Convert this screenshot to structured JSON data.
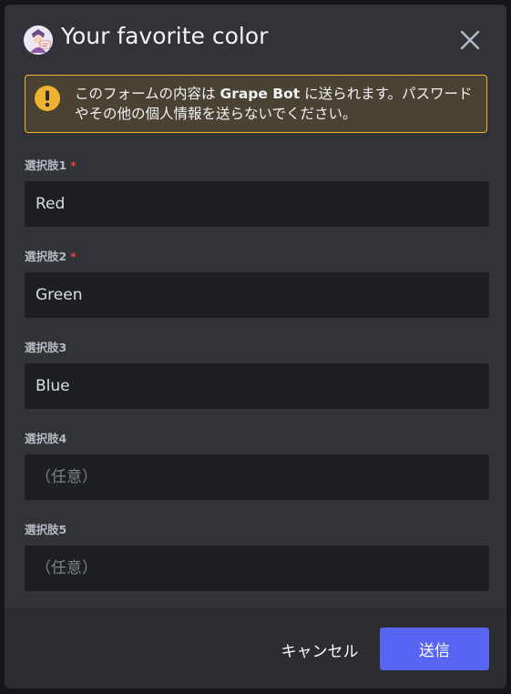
{
  "modal": {
    "title": "Your favorite color",
    "avatar_icon": "bot-avatar-icon",
    "close_icon": "close-icon"
  },
  "warning": {
    "icon": "exclamation-icon",
    "text_before": "このフォームの内容は ",
    "bot_name": "Grape Bot",
    "text_after": " に送られます。パスワードやその他の個人情報を送らないでください。",
    "border_color": "#f0b232"
  },
  "fields": [
    {
      "label": "選択肢1",
      "required": "*",
      "value": "Red",
      "placeholder": ""
    },
    {
      "label": "選択肢2",
      "required": "*",
      "value": "Green",
      "placeholder": ""
    },
    {
      "label": "選択肢3",
      "required": "",
      "value": "Blue",
      "placeholder": ""
    },
    {
      "label": "選択肢4",
      "required": "",
      "value": "",
      "placeholder": "（任意）"
    },
    {
      "label": "選択肢5",
      "required": "",
      "value": "",
      "placeholder": "（任意）"
    }
  ],
  "footer": {
    "cancel_label": "キャンセル",
    "submit_label": "送信"
  },
  "colors": {
    "accent": "#5865f2",
    "required": "#f23f43",
    "warning": "#f0b232"
  }
}
